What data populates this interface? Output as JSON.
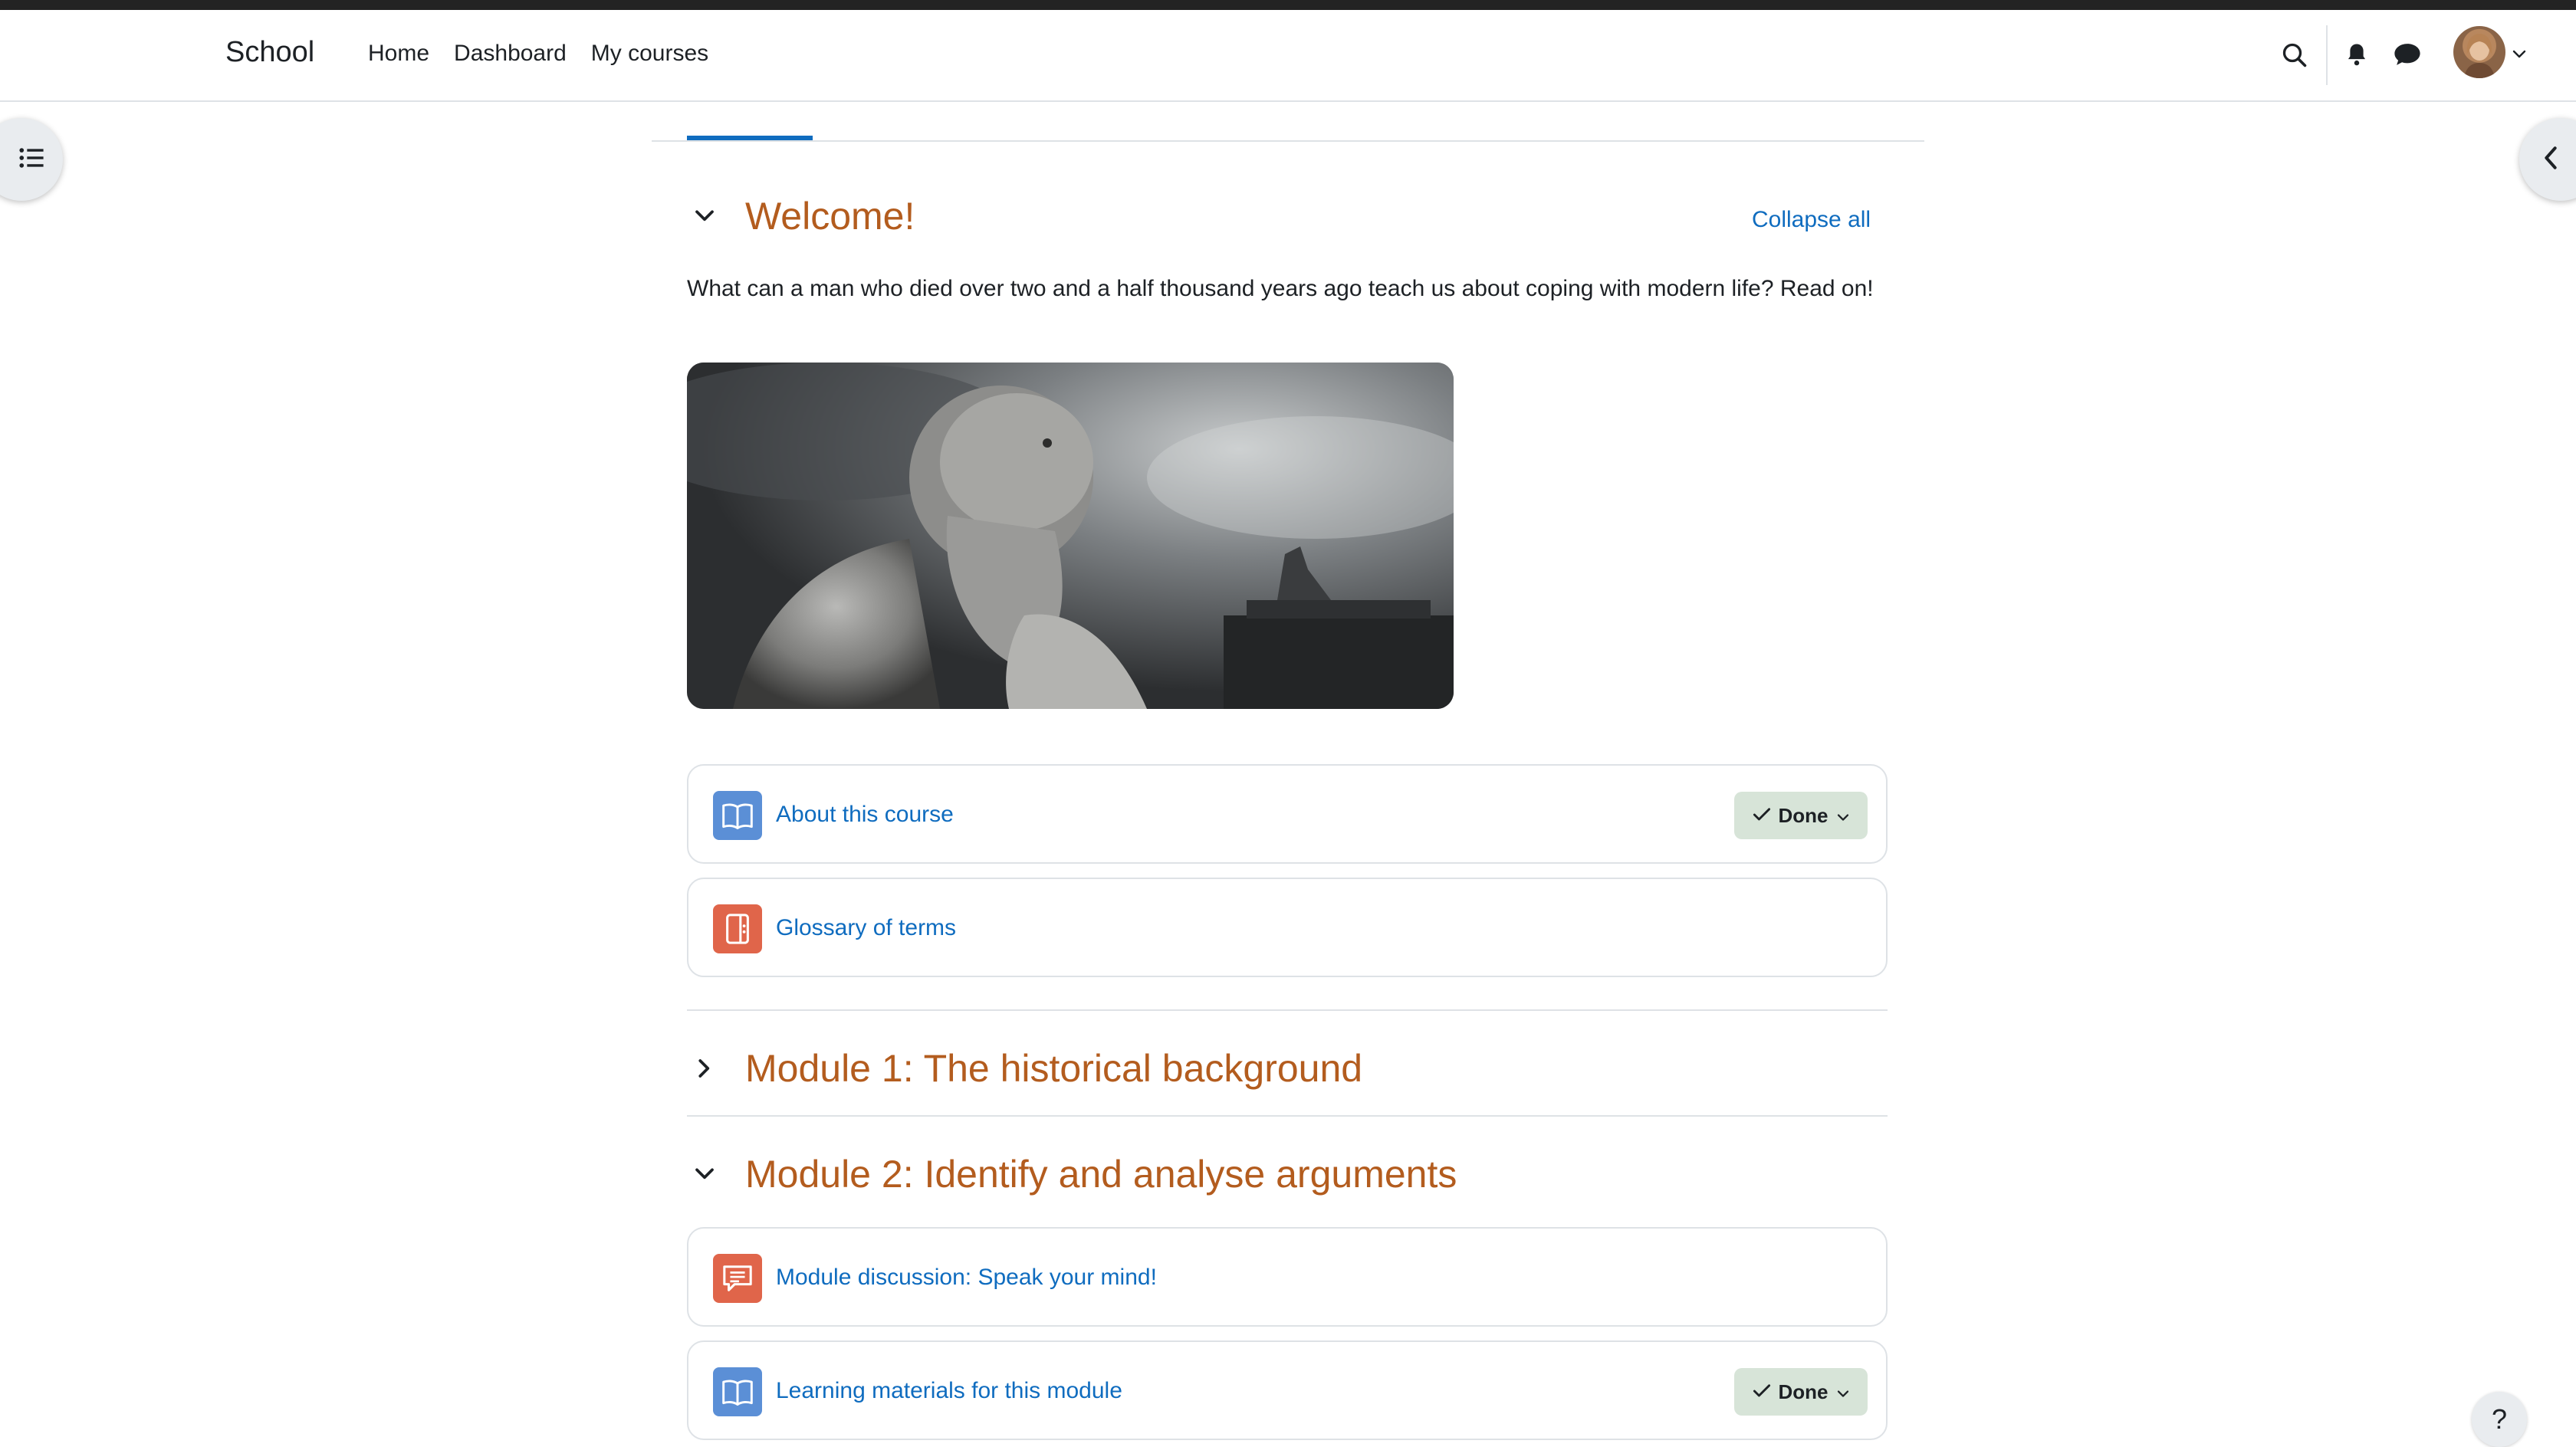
{
  "navbar": {
    "brand": "School",
    "links": [
      "Home",
      "Dashboard",
      "My courses"
    ]
  },
  "course": {
    "collapse_all": "Collapse all",
    "sections": [
      {
        "title": "Welcome!",
        "expanded": true,
        "summary": "What can a man who died over two and a half thousand years ago teach us about coping with modern life? Read on!",
        "activities": [
          {
            "label": "About this course",
            "icon": "book-icon",
            "completion": "Done"
          },
          {
            "label": "Glossary of terms",
            "icon": "glossary-icon",
            "completion": null
          }
        ]
      },
      {
        "title": "Module 1: The historical background",
        "expanded": false,
        "activities": []
      },
      {
        "title": "Module 2: Identify and analyse arguments",
        "expanded": true,
        "activities": [
          {
            "label": "Module discussion: Speak your mind!",
            "icon": "forum-icon",
            "completion": null
          },
          {
            "label": "Learning materials for this module",
            "icon": "book-icon",
            "completion": "Done"
          }
        ]
      }
    ]
  },
  "help": {
    "label": "?"
  },
  "colors": {
    "accent": "#0f6cbf",
    "section_title": "#b35c1e",
    "done_bg": "#d7e4d8",
    "book_icon_bg": "#5b8fd6",
    "red_icon_bg": "#e0654a"
  }
}
